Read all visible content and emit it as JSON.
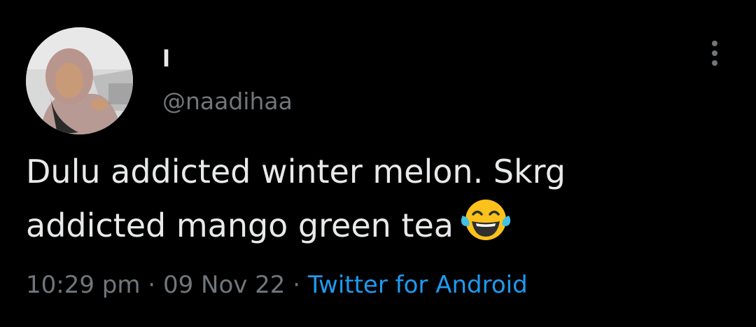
{
  "author": {
    "display_name": "l",
    "handle": "@naadihaa",
    "avatar_icon": "profile-photo"
  },
  "more_icon": "more-vertical-icon",
  "tweet": {
    "line1": "Dulu addicted winter melon. Skrg",
    "line2": "addicted mango green tea",
    "emoji": "face-with-tears-of-joy-icon"
  },
  "meta": {
    "time": "10:29 pm",
    "separator": " · ",
    "date": "09 Nov 22",
    "source": "Twitter for Android"
  },
  "colors": {
    "background": "#000000",
    "text": "#e7e9ea",
    "secondary": "#71767b",
    "link": "#1d9bf0"
  }
}
